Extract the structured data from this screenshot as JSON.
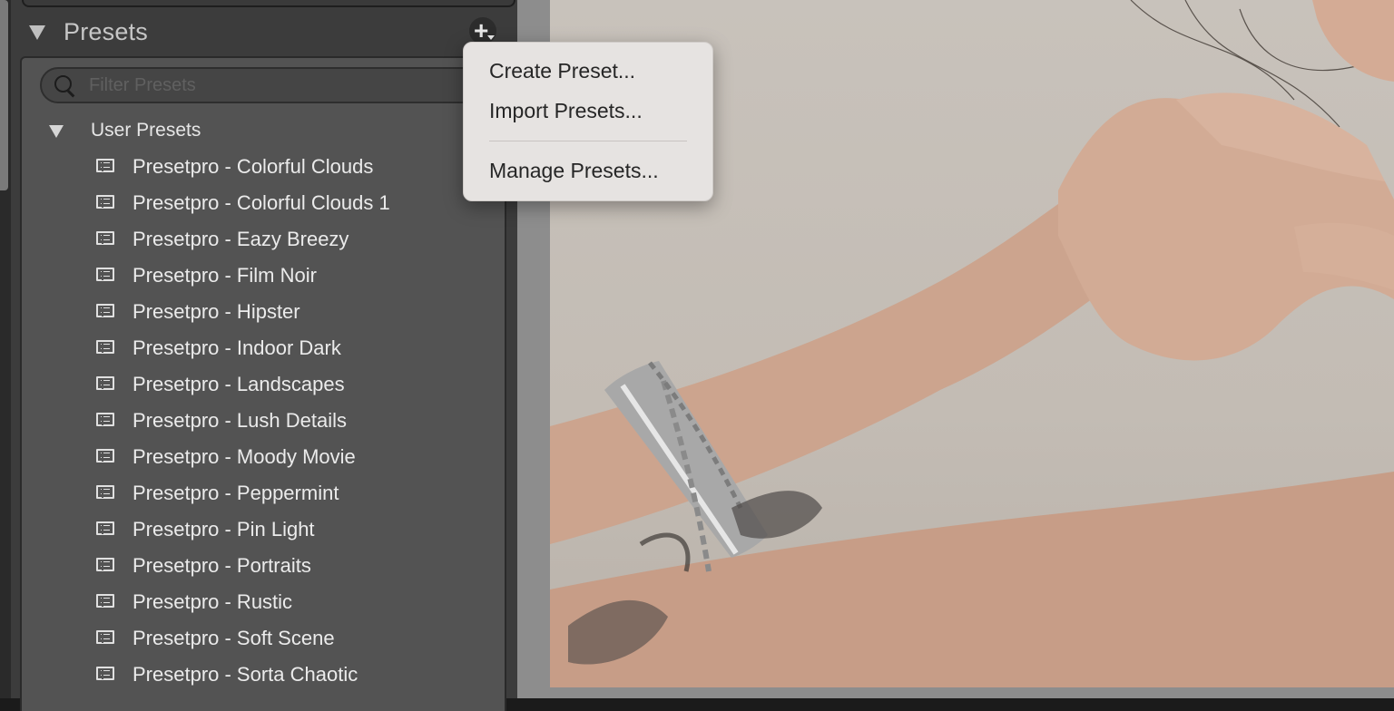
{
  "panel": {
    "title": "Presets",
    "search_placeholder": "Filter Presets",
    "group_label": "User Presets",
    "presets": [
      "Presetpro - Colorful Clouds",
      "Presetpro - Colorful Clouds 1",
      "Presetpro - Eazy Breezy",
      "Presetpro - Film Noir",
      "Presetpro - Hipster",
      "Presetpro - Indoor Dark",
      "Presetpro - Landscapes",
      "Presetpro - Lush Details",
      "Presetpro - Moody Movie",
      "Presetpro - Peppermint",
      "Presetpro - Pin Light",
      "Presetpro - Portraits",
      "Presetpro - Rustic",
      "Presetpro - Soft Scene",
      "Presetpro - Sorta Chaotic"
    ]
  },
  "add_button": {
    "icon": "plus-icon"
  },
  "menu": {
    "create": "Create Preset...",
    "import": "Import Presets...",
    "manage": "Manage Presets..."
  },
  "colors": {
    "panel_bg": "#3c3c3c",
    "list_bg": "#535353",
    "menu_bg": "#e6e3e1",
    "photo_backdrop": "#c6c0b9",
    "skin": "#caa18a"
  }
}
